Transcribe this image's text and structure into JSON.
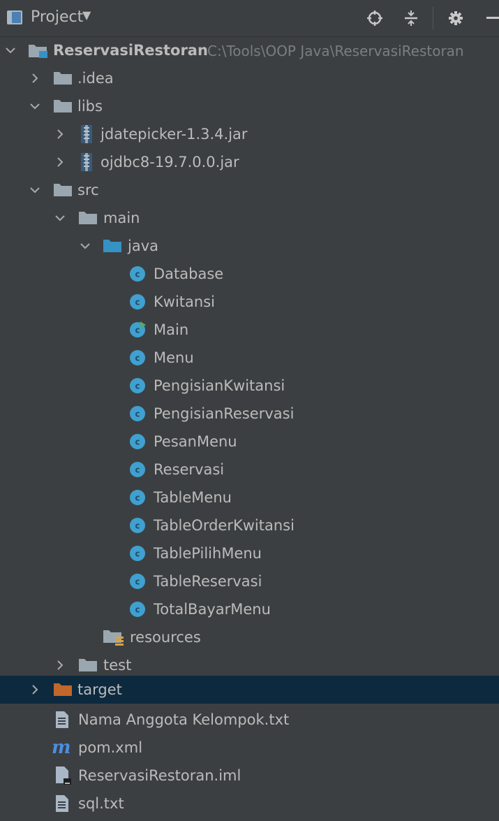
{
  "header": {
    "title": "Project",
    "caret": "▼",
    "icons": [
      "project-view-icon",
      "locate-icon",
      "collapse-all-icon",
      "gear-icon",
      "hide-icon"
    ]
  },
  "colors": {
    "background": "#3c3f41",
    "selection": "#0d293e",
    "folder": "#9aa7b0",
    "folder_blue": "#3592c4",
    "folder_orange": "#c0672b",
    "class_icon": "#40a0d0",
    "text": "#bbbbbb",
    "path_text": "#7b7e80"
  },
  "tree": {
    "project": {
      "name": "ReservasiRestoran",
      "path": "C:\\Tools\\OOP Java\\ReservasiRestoran"
    },
    "idea": ".idea",
    "libs": "libs",
    "jars": [
      "jdatepicker-1.3.4.jar",
      "ojdbc8-19.7.0.0.jar"
    ],
    "src": "src",
    "main": "main",
    "java": "java",
    "classes": [
      "Database",
      "Kwitansi",
      "Main",
      "Menu",
      "PengisianKwitansi",
      "PengisianReservasi",
      "PesanMenu",
      "Reservasi",
      "TableMenu",
      "TableOrderKwitansi",
      "TablePilihMenu",
      "TableReservasi",
      "TotalBayarMenu"
    ],
    "resources": "resources",
    "test": "test",
    "target": "target",
    "files": [
      "Nama Anggota Kelompok.txt",
      "pom.xml",
      "ReservasiRestoran.iml",
      "sql.txt"
    ]
  }
}
